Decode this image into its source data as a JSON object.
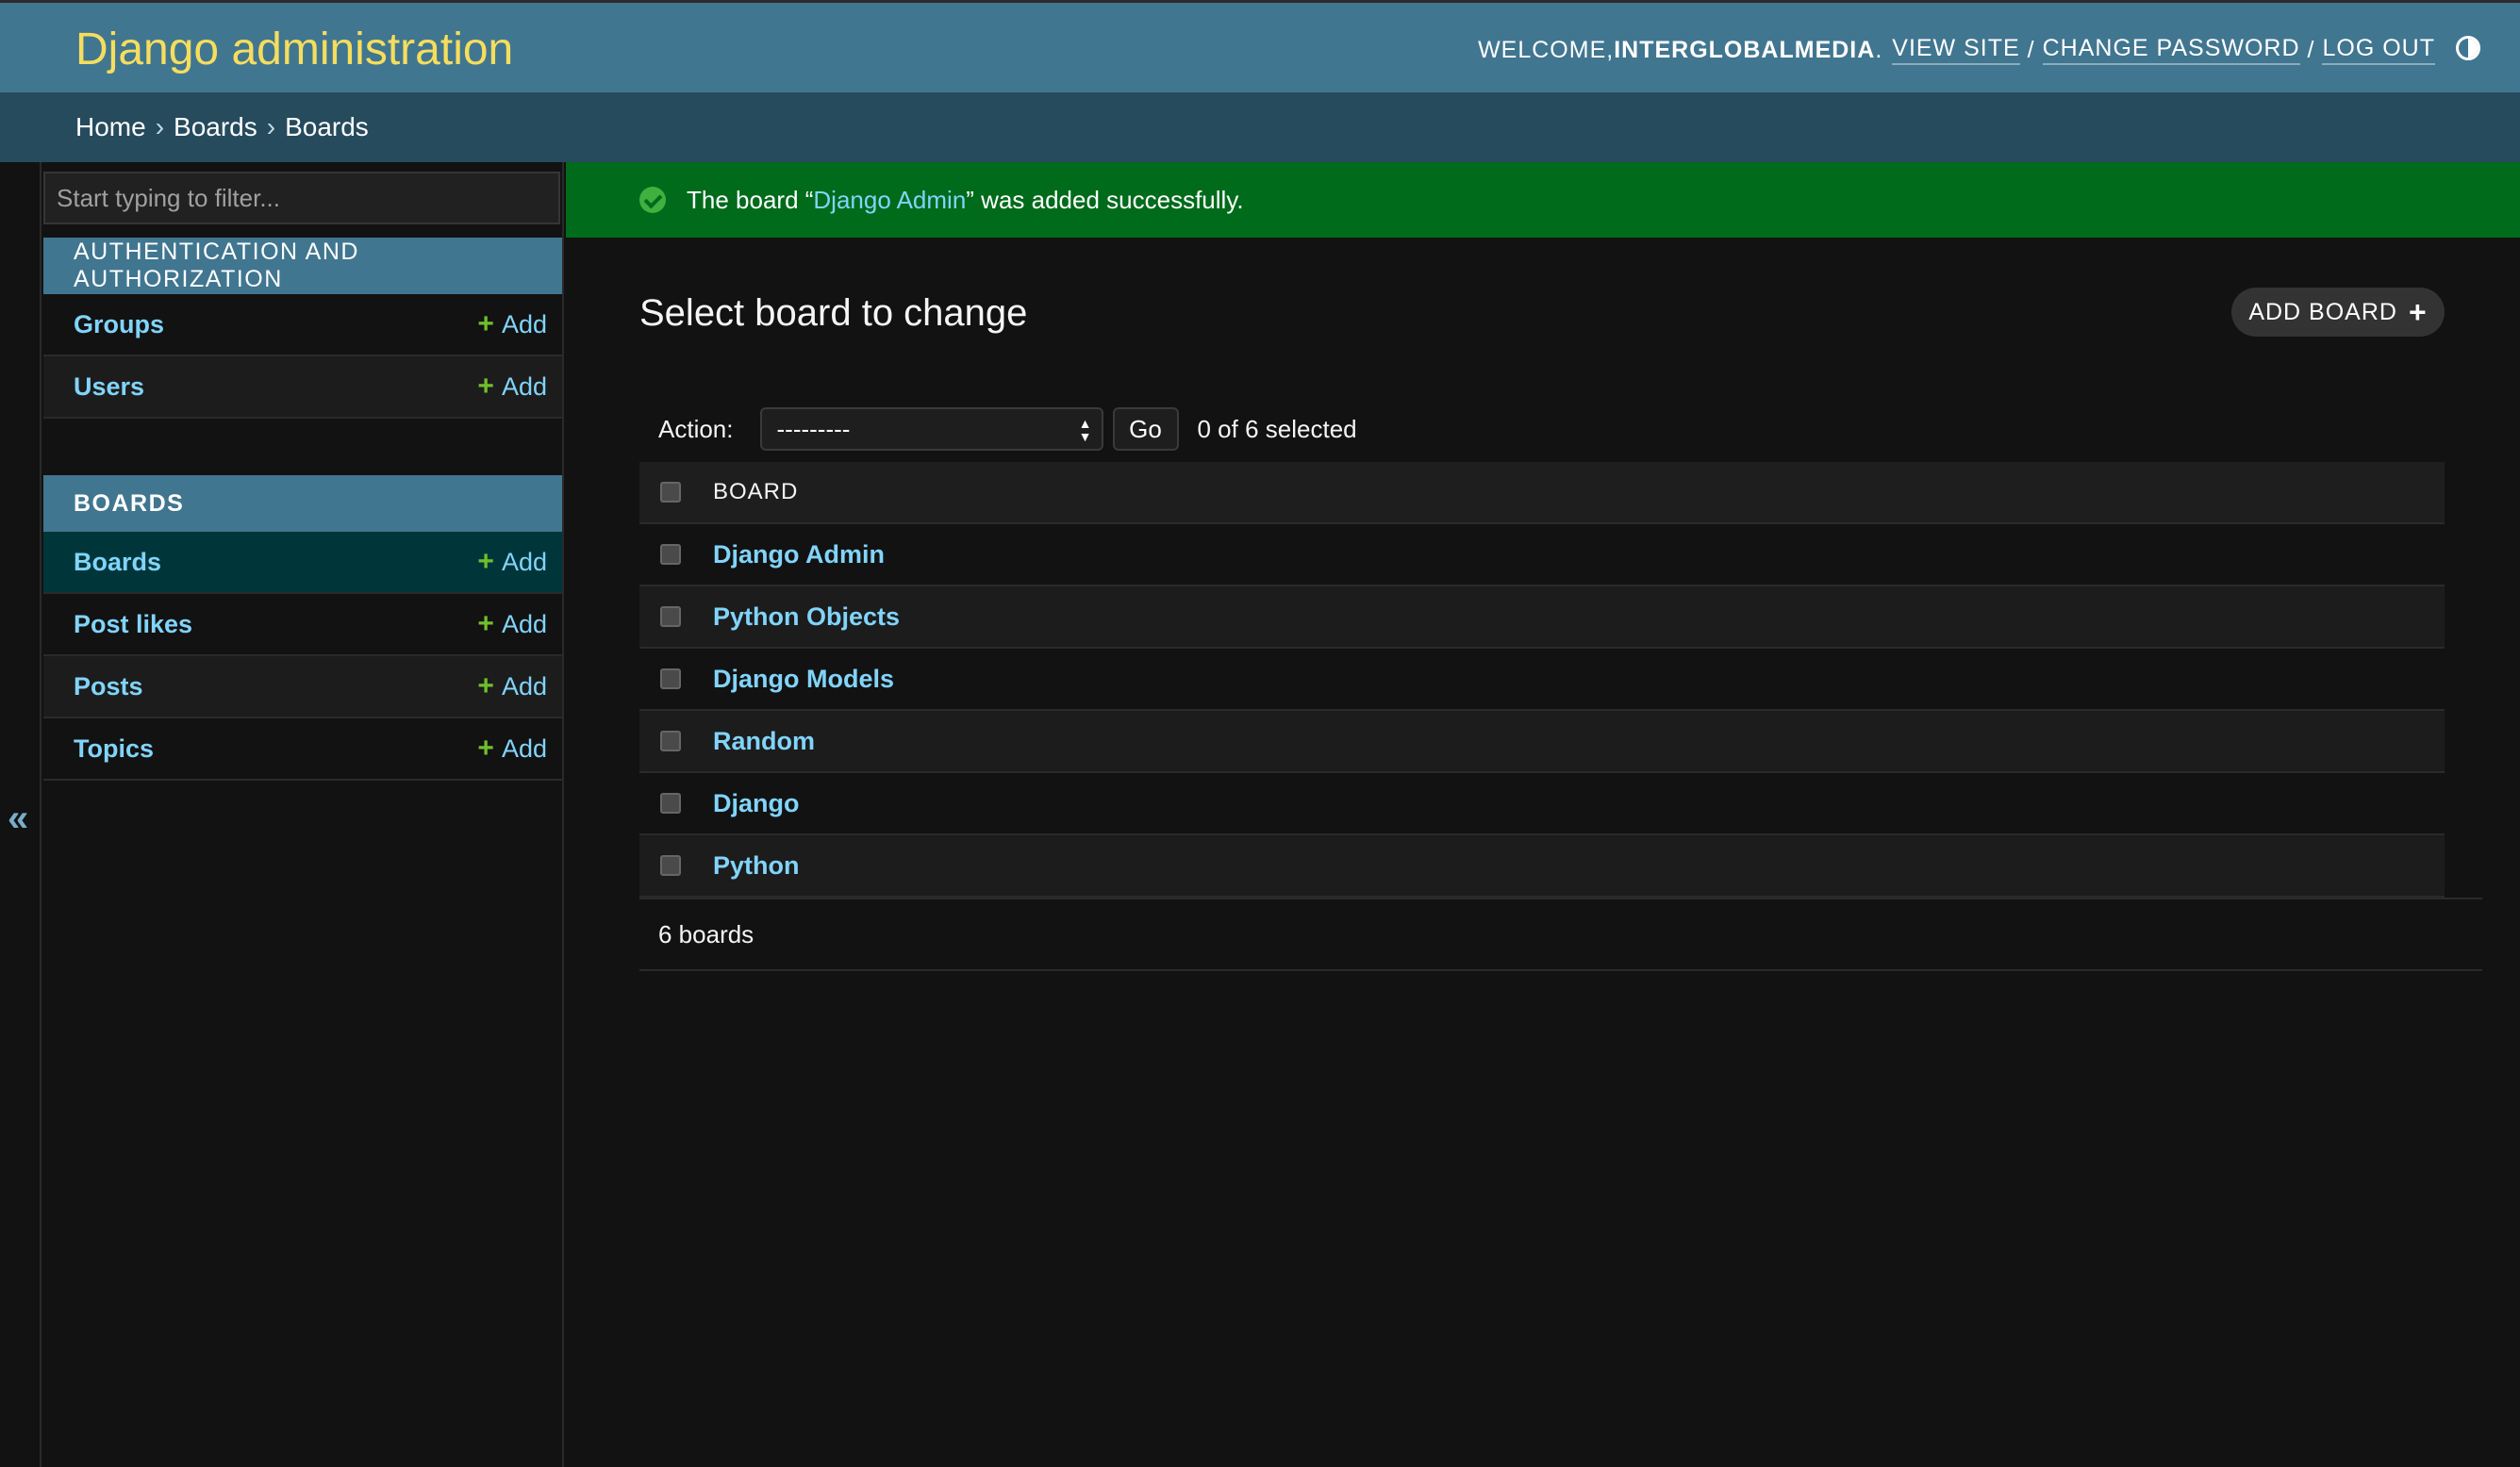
{
  "header": {
    "branding": "Django administration",
    "welcome": "WELCOME, ",
    "username": "INTERGLOBALMEDIA",
    "welcome_end": ".",
    "view_site": "VIEW SITE",
    "change_password": "CHANGE PASSWORD",
    "log_out": "LOG OUT",
    "separator": "/"
  },
  "breadcrumbs": {
    "home": "Home",
    "app": "Boards",
    "current": "Boards",
    "separator": "›"
  },
  "sidebar": {
    "filter_placeholder": "Start typing to filter...",
    "collapse_symbol": "«",
    "add_label": "Add",
    "modules": [
      {
        "caption": "AUTHENTICATION AND AUTHORIZATION",
        "models": [
          {
            "name": "Groups"
          },
          {
            "name": "Users"
          }
        ]
      },
      {
        "caption": "BOARDS",
        "models": [
          {
            "name": "Boards"
          },
          {
            "name": "Post likes"
          },
          {
            "name": "Posts"
          },
          {
            "name": "Topics"
          }
        ]
      }
    ]
  },
  "message": {
    "prefix": "The board “",
    "link": "Django Admin",
    "suffix": "” was added successfully."
  },
  "main": {
    "title": "Select board to change",
    "add_button": "ADD BOARD",
    "action_label": "Action:",
    "action_value": "---------",
    "go_label": "Go",
    "selected_counter": "0 of 6 selected",
    "column_header": "BOARD",
    "rows": [
      "Django Admin",
      "Python Objects",
      "Django Models",
      "Random",
      "Django",
      "Python"
    ],
    "paginator": "6 boards"
  },
  "colors": {
    "header_bg": "#417690",
    "breadcrumbs_bg": "#264b5d",
    "branding": "#f5dd5d",
    "link": "#81d4fa",
    "success_bg": "#006b1b",
    "add_plus": "#70bf2b"
  }
}
